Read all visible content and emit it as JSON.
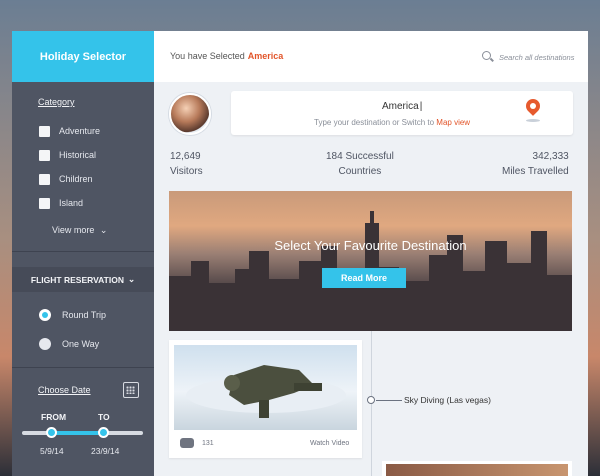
{
  "sidebar": {
    "brand": "Holiday Selector",
    "category_title": "Category",
    "categories": [
      "Adventure",
      "Historical",
      "Children",
      "Island"
    ],
    "view_more": "View more",
    "flight_title": "FLIGHT RESERVATION",
    "trip_options": [
      {
        "label": "Round Trip",
        "selected": true
      },
      {
        "label": "One Way",
        "selected": false
      }
    ],
    "choose_date": "Choose Date",
    "from_label": "FROM",
    "to_label": "TO",
    "from_date": "5/9/14",
    "to_date": "23/9/14",
    "accent": "#34c3ea"
  },
  "topbar": {
    "selected_prefix": "You have Selected",
    "selected_value": "America",
    "search_placeholder": "Search all destinations"
  },
  "destination": {
    "value": "America",
    "hint_prefix": "Type your destination or Switch to",
    "map_link": "Map view"
  },
  "stats": [
    {
      "value": "12,649",
      "label": "Visitors"
    },
    {
      "value": "184 Successful",
      "label": "Countries"
    },
    {
      "value": "342,333",
      "label": "Miles Travelled"
    }
  ],
  "hero": {
    "title": "Select Your Favourite  Destination",
    "button": "Read More"
  },
  "timeline": {
    "label": "Sky Diving  (Las vegas)"
  },
  "video_card": {
    "comments": "131",
    "watch": "Watch Video"
  }
}
